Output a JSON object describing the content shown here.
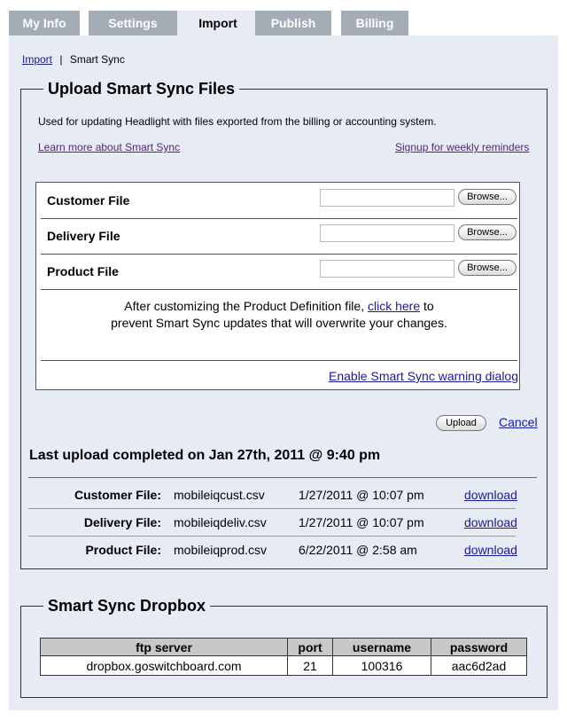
{
  "tabs": [
    "My Info",
    "Settings",
    "Import",
    "Publish",
    "Billing"
  ],
  "breadcrumb": {
    "link": "Import",
    "separator": "|",
    "current": "Smart Sync"
  },
  "upload": {
    "title": "Upload Smart Sync Files",
    "description": "Used for updating Headlight with files exported from the billing or accounting system.",
    "learn_more": "Learn more about Smart Sync",
    "signup": "Signup for weekly reminders",
    "files": [
      {
        "label": "Customer File",
        "browse": "Browse..."
      },
      {
        "label": "Delivery File",
        "browse": "Browse..."
      },
      {
        "label": "Product File",
        "browse": "Browse..."
      }
    ],
    "note_before": "After customizing the Product Definition file,",
    "note_link": "click here",
    "note_after": "to",
    "note_line2": "prevent Smart Sync updates that will overwrite your changes.",
    "warning_link": "Enable Smart Sync warning dialog",
    "upload_button": "Upload",
    "cancel": "Cancel",
    "last_upload": "Last upload completed on Jan 27th, 2011 @ 9:40 pm",
    "history": [
      {
        "type": "Customer File:",
        "file": "mobileiqcust.csv",
        "date": "1/27/2011 @ 10:07 pm",
        "action": "download"
      },
      {
        "type": "Delivery File:",
        "file": "mobileiqdeliv.csv",
        "date": "1/27/2011 @ 10:07 pm",
        "action": "download"
      },
      {
        "type": "Product File:",
        "file": "mobileiqprod.csv",
        "date": "6/22/2011 @ 2:58 am",
        "action": "download"
      }
    ]
  },
  "dropbox": {
    "title": "Smart Sync Dropbox",
    "headers": [
      "ftp server",
      "port",
      "username",
      "password"
    ],
    "row": [
      "dropbox.goswitchboard.com",
      "21",
      "100316",
      "aac6d2ad"
    ]
  }
}
